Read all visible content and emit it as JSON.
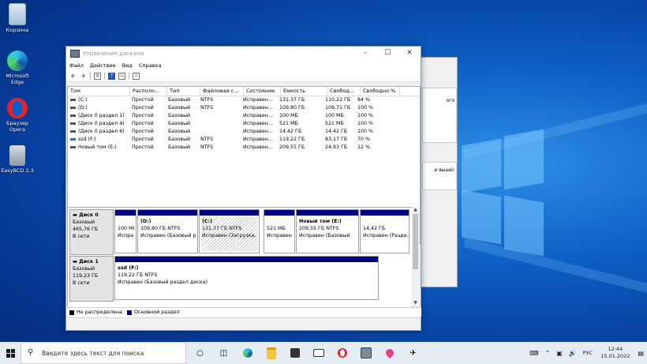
{
  "desktop": {
    "icons": [
      {
        "label": "Корзина"
      },
      {
        "label": "Microsoft Edge"
      },
      {
        "label": "Браузер Opera"
      },
      {
        "label": "EasyBCD 2.3"
      }
    ],
    "background_window": {
      "text1": "ого",
      "text2": "и выше)"
    }
  },
  "window": {
    "title": "Управление дисками",
    "menu": [
      "Файл",
      "Действие",
      "Вид",
      "Справка"
    ],
    "columns": [
      "Том",
      "Располо...",
      "Тип",
      "Файловая с...",
      "Состояние",
      "Емкость",
      "Свобод...",
      "Свободно %"
    ],
    "volumes": [
      {
        "name": "(C:)",
        "layout": "Простой",
        "type": "Базовый",
        "fs": "NTFS",
        "status": "Исправен...",
        "capacity": "131,37 ГБ",
        "free": "110,22 ГБ",
        "free_pct": "84 %",
        "icon": "disk"
      },
      {
        "name": "(D:)",
        "layout": "Простой",
        "type": "Базовый",
        "fs": "NTFS",
        "status": "Исправен...",
        "capacity": "109,80 ГБ",
        "free": "109,71 ГБ",
        "free_pct": "100 %",
        "icon": "disk"
      },
      {
        "name": "(Диск 0 раздел 1)",
        "layout": "Простой",
        "type": "Базовый",
        "fs": "",
        "status": "Исправен...",
        "capacity": "100 МБ",
        "free": "100 МБ",
        "free_pct": "100 %",
        "icon": "disk"
      },
      {
        "name": "(Диск 0 раздел 4)",
        "layout": "Простой",
        "type": "Базовый",
        "fs": "",
        "status": "Исправен...",
        "capacity": "521 МБ",
        "free": "521 МБ",
        "free_pct": "100 %",
        "icon": "disk"
      },
      {
        "name": "(Диск 0 раздел 6)",
        "layout": "Простой",
        "type": "Базовый",
        "fs": "",
        "status": "Исправен...",
        "capacity": "14,42 ГБ",
        "free": "14,42 ГБ",
        "free_pct": "100 %",
        "icon": "disk"
      },
      {
        "name": "ssd (F:)",
        "layout": "Простой",
        "type": "Базовый",
        "fs": "NTFS",
        "status": "Исправен...",
        "capacity": "119,22 ГБ",
        "free": "83,17 ГБ",
        "free_pct": "70 %",
        "icon": "usb"
      },
      {
        "name": "Новый том (E:)",
        "layout": "Простой",
        "type": "Базовый",
        "fs": "NTFS",
        "status": "Исправен...",
        "capacity": "209,55 ГБ",
        "free": "24,93 ГБ",
        "free_pct": "12 %",
        "icon": "disk"
      }
    ],
    "disks": [
      {
        "name": "Диск 0",
        "type": "Базовый",
        "size": "465,76 ГБ",
        "state": "В сети",
        "partitions": [
          {
            "title": "",
            "line1": "100 МІ",
            "line2": "Испра",
            "hatch": false
          },
          {
            "title": "(D:)",
            "line1": "109,80 ГБ NTFS",
            "line2": "Исправен (Базовый р",
            "hatch": false
          },
          {
            "title": "(C:)",
            "line1": "131,37 ГБ NTFS",
            "line2": "Исправен (Загрузка,",
            "hatch": true
          },
          {
            "title": "",
            "line1": "521 МБ",
            "line2": "Исправен",
            "hatch": false
          },
          {
            "title": "Новый том (E:)",
            "line1": "209,55 ГБ NTFS",
            "line2": "Исправен (Базовый",
            "hatch": false
          },
          {
            "title": "",
            "line1": "14,42 ГБ",
            "line2": "Исправен (Разде.",
            "hatch": false
          }
        ]
      },
      {
        "name": "Диск 1",
        "type": "Базовый",
        "size": "119,23 ГБ",
        "state": "В сети",
        "partitions": [
          {
            "title": "ssd  (F:)",
            "line1": "119,22 ГБ NTFS",
            "line2": "Исправен (Базовый раздел диска)",
            "hatch": false
          }
        ]
      }
    ],
    "legend": {
      "unallocated": "Не распределена",
      "primary": "Основной раздел"
    }
  },
  "taskbar": {
    "search_placeholder": "Введите здесь текст для поиска",
    "lang": "РУС",
    "time": "12:44",
    "date": "15.01.2022"
  },
  "colors": {
    "primary_partition": "#000080",
    "unallocated": "#000000"
  }
}
